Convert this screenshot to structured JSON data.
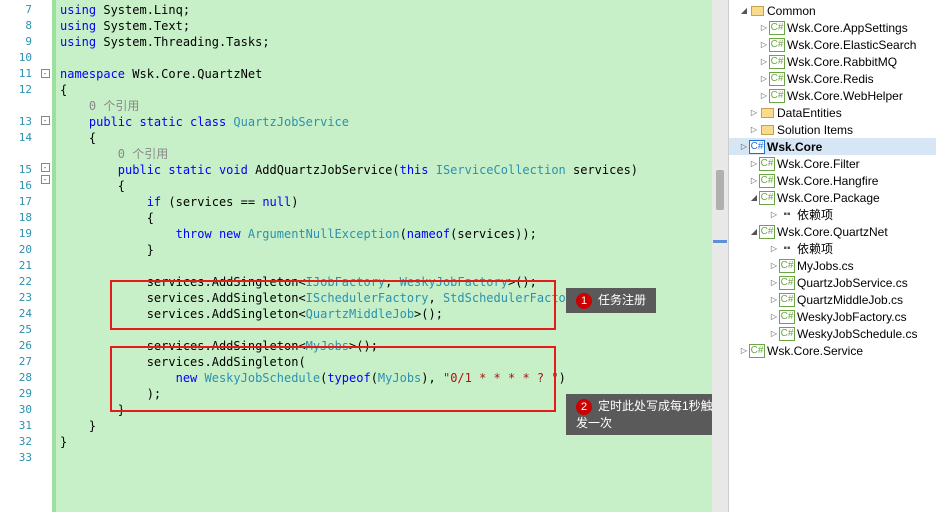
{
  "lines": [
    7,
    8,
    9,
    10,
    11,
    12,
    "",
    13,
    14,
    "",
    15,
    16,
    17,
    18,
    19,
    20,
    21,
    22,
    23,
    24,
    25,
    26,
    27,
    28,
    29,
    30,
    31,
    32,
    33
  ],
  "code": {
    "l7": [
      "using ",
      "System.Linq",
      ";"
    ],
    "l8": [
      "using ",
      "System.Text",
      ";"
    ],
    "l9": [
      "using ",
      "System.Threading.Tasks",
      ";"
    ],
    "l11_ns": "namespace",
    "l11_name": " Wsk.Core.QuartzNet",
    "refs": "0 个引用",
    "l13_mod": "public static class ",
    "l13_name": "QuartzJobService",
    "l15_mod": "public static void ",
    "l15_method": "AddQuartzJobService",
    "l15_this": "(this ",
    "l15_type": "IServiceCollection",
    "l15_param": " services)",
    "l17_if": "if",
    "l17_cond": " (services == ",
    "l17_null": "null",
    "l17_close": ")",
    "l19_throw": "throw new ",
    "l19_ex": "ArgumentNullException",
    "l19_nameof": "(nameof",
    "l19_arg": "(services));",
    "svc": "services.",
    "add": "AddSingleton",
    "l22_t1": "IJobFactory",
    "l22_t2": "WeskyJobFactory",
    "l23_t1": "ISchedulerFactory",
    "l23_t2": "StdSchedulerFactory",
    "l24_t1": "QuartzMiddleJob",
    "l26_t1": "MyJobs",
    "l28_new": "new ",
    "l28_sched": "WeskyJobSchedule",
    "l28_typeof": "(typeof",
    "l28_mj": "MyJobs",
    "l28_cron": "\"0/1 * * * * ? \"",
    "end": ">();",
    "endp": "();",
    "close_paren": ")"
  },
  "callout1": "任务注册",
  "callout2": "定时此处写成每1秒触发一次",
  "tree": {
    "n0": "Common",
    "n1": "Wsk.Core.AppSettings",
    "n2": "Wsk.Core.ElasticSearch",
    "n3": "Wsk.Core.RabbitMQ",
    "n4": "Wsk.Core.Redis",
    "n5": "Wsk.Core.WebHelper",
    "n6": "DataEntities",
    "n7": "Solution Items",
    "n8": "Wsk.Core",
    "n9": "Wsk.Core.Filter",
    "n10": "Wsk.Core.Hangfire",
    "n11": "Wsk.Core.Package",
    "n12": "依赖项",
    "n13": "Wsk.Core.QuartzNet",
    "n14": "依赖项",
    "n15": "MyJobs.cs",
    "n16": "QuartzJobService.cs",
    "n17": "QuartzMiddleJob.cs",
    "n18": "WeskyJobFactory.cs",
    "n19": "WeskyJobSchedule.cs",
    "n20": "Wsk.Core.Service",
    "cs": "C#"
  }
}
